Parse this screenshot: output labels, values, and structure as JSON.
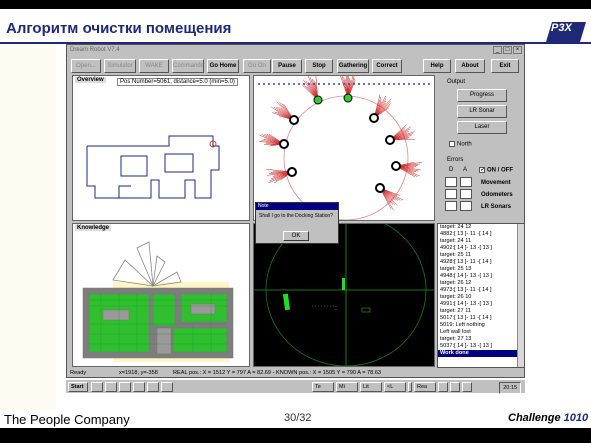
{
  "slide": {
    "title": "Алгоритм очистки помещения",
    "company": "The People Company",
    "page": "30/32",
    "challenge_prefix": "Challenge",
    "challenge_number": "1010",
    "logo_text": "P3X"
  },
  "window": {
    "title": "Dream Robot V7.4",
    "toolbar": [
      {
        "label": "Open...",
        "enabled": false
      },
      {
        "label": "Simulator",
        "enabled": false
      },
      {
        "label": "WAKE",
        "enabled": false
      },
      {
        "label": "Commands",
        "enabled": false
      },
      {
        "label": "Go Home",
        "enabled": true
      },
      {
        "label": "Go On",
        "enabled": false
      },
      {
        "label": "Pause",
        "enabled": true
      },
      {
        "label": "Stop",
        "enabled": true
      },
      {
        "label": "Gathering",
        "enabled": true
      },
      {
        "label": "Correct",
        "enabled": true
      },
      {
        "label": "Help",
        "enabled": true
      },
      {
        "label": "About",
        "enabled": true
      },
      {
        "label": "Exit",
        "enabled": true
      }
    ]
  },
  "overview": {
    "label": "Overview",
    "pos_info": "Pos Number=5061, distance=5.0 (min=5.0)"
  },
  "knowledge": {
    "label": "Knowledge"
  },
  "output": {
    "title": "Output",
    "buttons": [
      "Progress",
      "LR Sonar",
      "Laser"
    ],
    "north_label": "North"
  },
  "errors": {
    "title": "Errors",
    "col_d": "D",
    "col_a": "A",
    "items": [
      "ON / OFF",
      "Movement",
      "Odometers",
      "LR Sonars"
    ]
  },
  "log": {
    "lines": [
      "target: 24  12",
      "4882:[ 13 ]- 11 -[ 14 ]",
      "target: 24  11",
      "4902:[ 14 ]- 13 -[ 13 ]",
      "target: 25  11",
      "4928:[ 13 ]- 11 -[ 14 ]",
      "target: 25  13",
      "4948:[ 14 ]- 13 -[ 13 ]",
      "target: 26  12",
      "4973:[ 13 ]- 11 -[ 14 ]",
      "target: 26  10",
      "4991:[ 14 ]- 13 -[ 13 ]",
      "target: 27  11",
      "5017:[ 13 ]- 11 -[ 14 ]",
      "5019: Left nothing",
      "  Left wall lost",
      "target: 27  13",
      "5037:[ 14 ]- 13 -[ 13 ]",
      "Work done"
    ]
  },
  "dialog": {
    "title": "Note",
    "message": "Shall I go to the Docking Station?",
    "ok_label": "OK"
  },
  "status": {
    "ready": "Ready",
    "coords": "x=1918, y=-358",
    "real_pos": "REAL pos.: X = 1512  Y = 797  A = 82.69  -  KNOWN pos.: X = 1505  Y = 790  A = 78.63"
  },
  "taskbar": {
    "start": "Start",
    "tasks": [
      "",
      "",
      "",
      "",
      "",
      "",
      "Te",
      "Mi",
      "Lit",
      "<L",
      "",
      "Rea",
      "",
      "",
      ""
    ],
    "clock": "20:15"
  }
}
